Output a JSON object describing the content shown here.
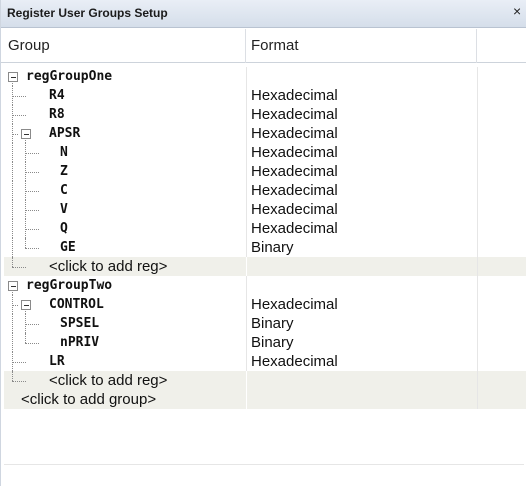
{
  "window": {
    "title": "Register User Groups Setup",
    "close_glyph": "×"
  },
  "columns": {
    "group": "Group",
    "format": "Format"
  },
  "rows": [
    {
      "label": "regGroupOne",
      "format": "",
      "style": "mono",
      "depth": 0,
      "expander": true
    },
    {
      "label": "R4",
      "format": "Hexadecimal",
      "style": "mono",
      "depth": 1
    },
    {
      "label": "R8",
      "format": "Hexadecimal",
      "style": "mono",
      "depth": 1
    },
    {
      "label": "APSR",
      "format": "Hexadecimal",
      "style": "mono",
      "depth": 1,
      "expander": true
    },
    {
      "label": "N",
      "format": "Hexadecimal",
      "style": "mono",
      "depth": 2
    },
    {
      "label": "Z",
      "format": "Hexadecimal",
      "style": "mono",
      "depth": 2
    },
    {
      "label": "C",
      "format": "Hexadecimal",
      "style": "mono",
      "depth": 2
    },
    {
      "label": "V",
      "format": "Hexadecimal",
      "style": "mono",
      "depth": 2
    },
    {
      "label": "Q",
      "format": "Hexadecimal",
      "style": "mono",
      "depth": 2
    },
    {
      "label": "GE",
      "format": "Binary",
      "style": "mono",
      "depth": 2
    },
    {
      "label": "<click to add reg>",
      "format": "",
      "style": "plain",
      "depth": 1,
      "shaded": true
    },
    {
      "label": "regGroupTwo",
      "format": "",
      "style": "mono",
      "depth": 0,
      "expander": true
    },
    {
      "label": "CONTROL",
      "format": "Hexadecimal",
      "style": "mono",
      "depth": 1,
      "expander": true
    },
    {
      "label": "SPSEL",
      "format": "Binary",
      "style": "mono",
      "depth": 2
    },
    {
      "label": "nPRIV",
      "format": "Binary",
      "style": "mono",
      "depth": 2
    },
    {
      "label": "LR",
      "format": "Hexadecimal",
      "style": "mono",
      "depth": 1
    },
    {
      "label": "<click to add reg>",
      "format": "",
      "style": "plain",
      "depth": 1,
      "shaded": true
    },
    {
      "label": "<click to add group>",
      "format": "",
      "style": "plain",
      "depth": 0,
      "shaded": true,
      "noexpander": true
    }
  ]
}
